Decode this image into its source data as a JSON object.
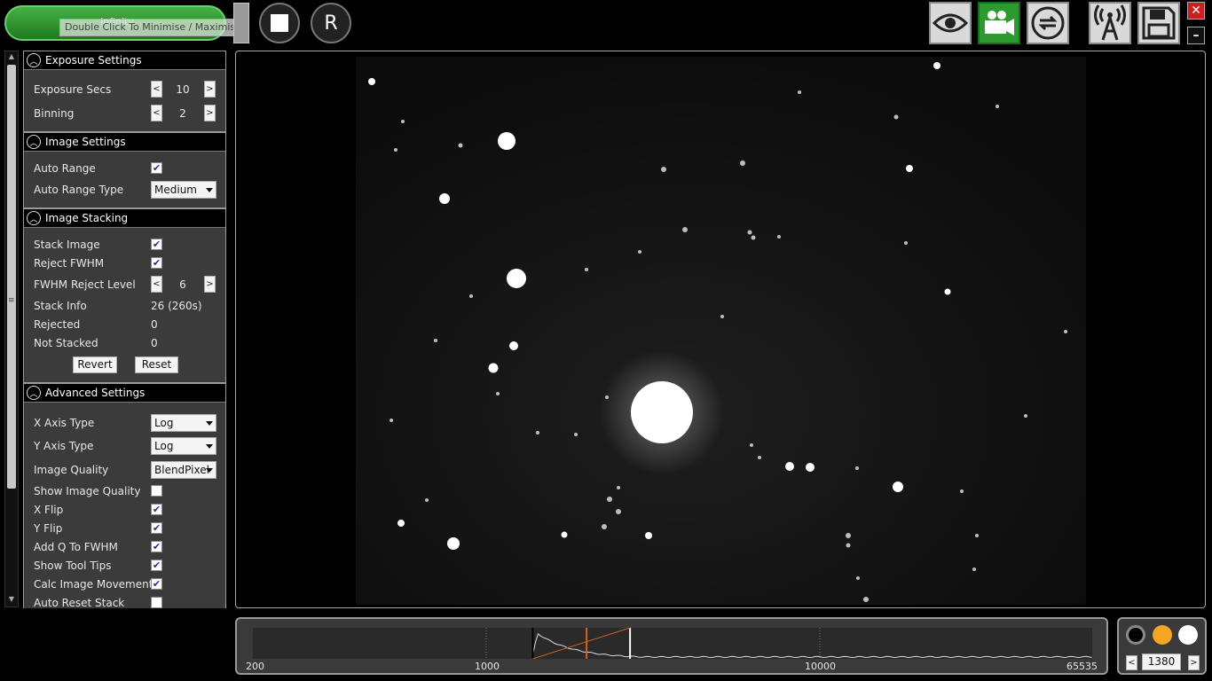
{
  "toolbar": {
    "focus_label": "Infinity",
    "tooltip": "Double Click To Minimise / Maximise",
    "stop_icon": "stop-icon",
    "reset_label": "R",
    "icons": [
      "eye-icon",
      "camera-icon",
      "loop-icon",
      "antenna-icon",
      "save-icon"
    ],
    "active_color": "#2f9a2f",
    "close_label": "✕",
    "minimize_label": "–"
  },
  "exposure": {
    "title": "Exposure Settings",
    "exposure_label": "Exposure Secs",
    "exposure_value": "10",
    "binning_label": "Binning",
    "binning_value": "2"
  },
  "image_settings": {
    "title": "Image Settings",
    "auto_range_label": "Auto Range",
    "auto_range_checked": true,
    "auto_range_type_label": "Auto Range Type",
    "auto_range_type_value": "Medium"
  },
  "stacking": {
    "title": "Image Stacking",
    "stack_image_label": "Stack Image",
    "stack_image_checked": true,
    "reject_fwhm_label": "Reject FWHM",
    "reject_fwhm_checked": true,
    "fwhm_level_label": "FWHM Reject Level",
    "fwhm_level_value": "6",
    "stack_info_label": "Stack Info",
    "stack_info_value": "26 (260s)",
    "rejected_label": "Rejected",
    "rejected_value": "0",
    "not_stacked_label": "Not Stacked",
    "not_stacked_value": "0",
    "revert_label": "Revert",
    "reset_label": "Reset"
  },
  "advanced": {
    "title": "Advanced Settings",
    "x_axis_label": "X Axis Type",
    "x_axis_value": "Log",
    "y_axis_label": "Y Axis Type",
    "y_axis_value": "Log",
    "quality_label": "Image Quality",
    "quality_value": "BlendPixel",
    "show_quality_label": "Show Image Quality",
    "show_quality_checked": false,
    "xflip_label": "X Flip",
    "xflip_checked": true,
    "yflip_label": "Y Flip",
    "yflip_checked": true,
    "addq_label": "Add Q To FWHM",
    "addq_checked": true,
    "tooltips_label": "Show Tool Tips",
    "tooltips_checked": true,
    "calc_label": "Calc Image Movement",
    "calc_checked": true,
    "autoreset_label": "Auto Reset Stack",
    "autoreset_checked": false
  },
  "histogram": {
    "tick_labels": [
      "200",
      "1000",
      "10000",
      "65535"
    ],
    "tick_values": [
      200,
      1000,
      10000,
      65535
    ],
    "black_point": 1380,
    "mid_point": 2000,
    "white_point": 2700
  },
  "color_box": {
    "colors": [
      "#000000",
      "#f5a623",
      "#ffffff"
    ],
    "value": "1380",
    "dec_label": "<",
    "inc_label": ">"
  }
}
